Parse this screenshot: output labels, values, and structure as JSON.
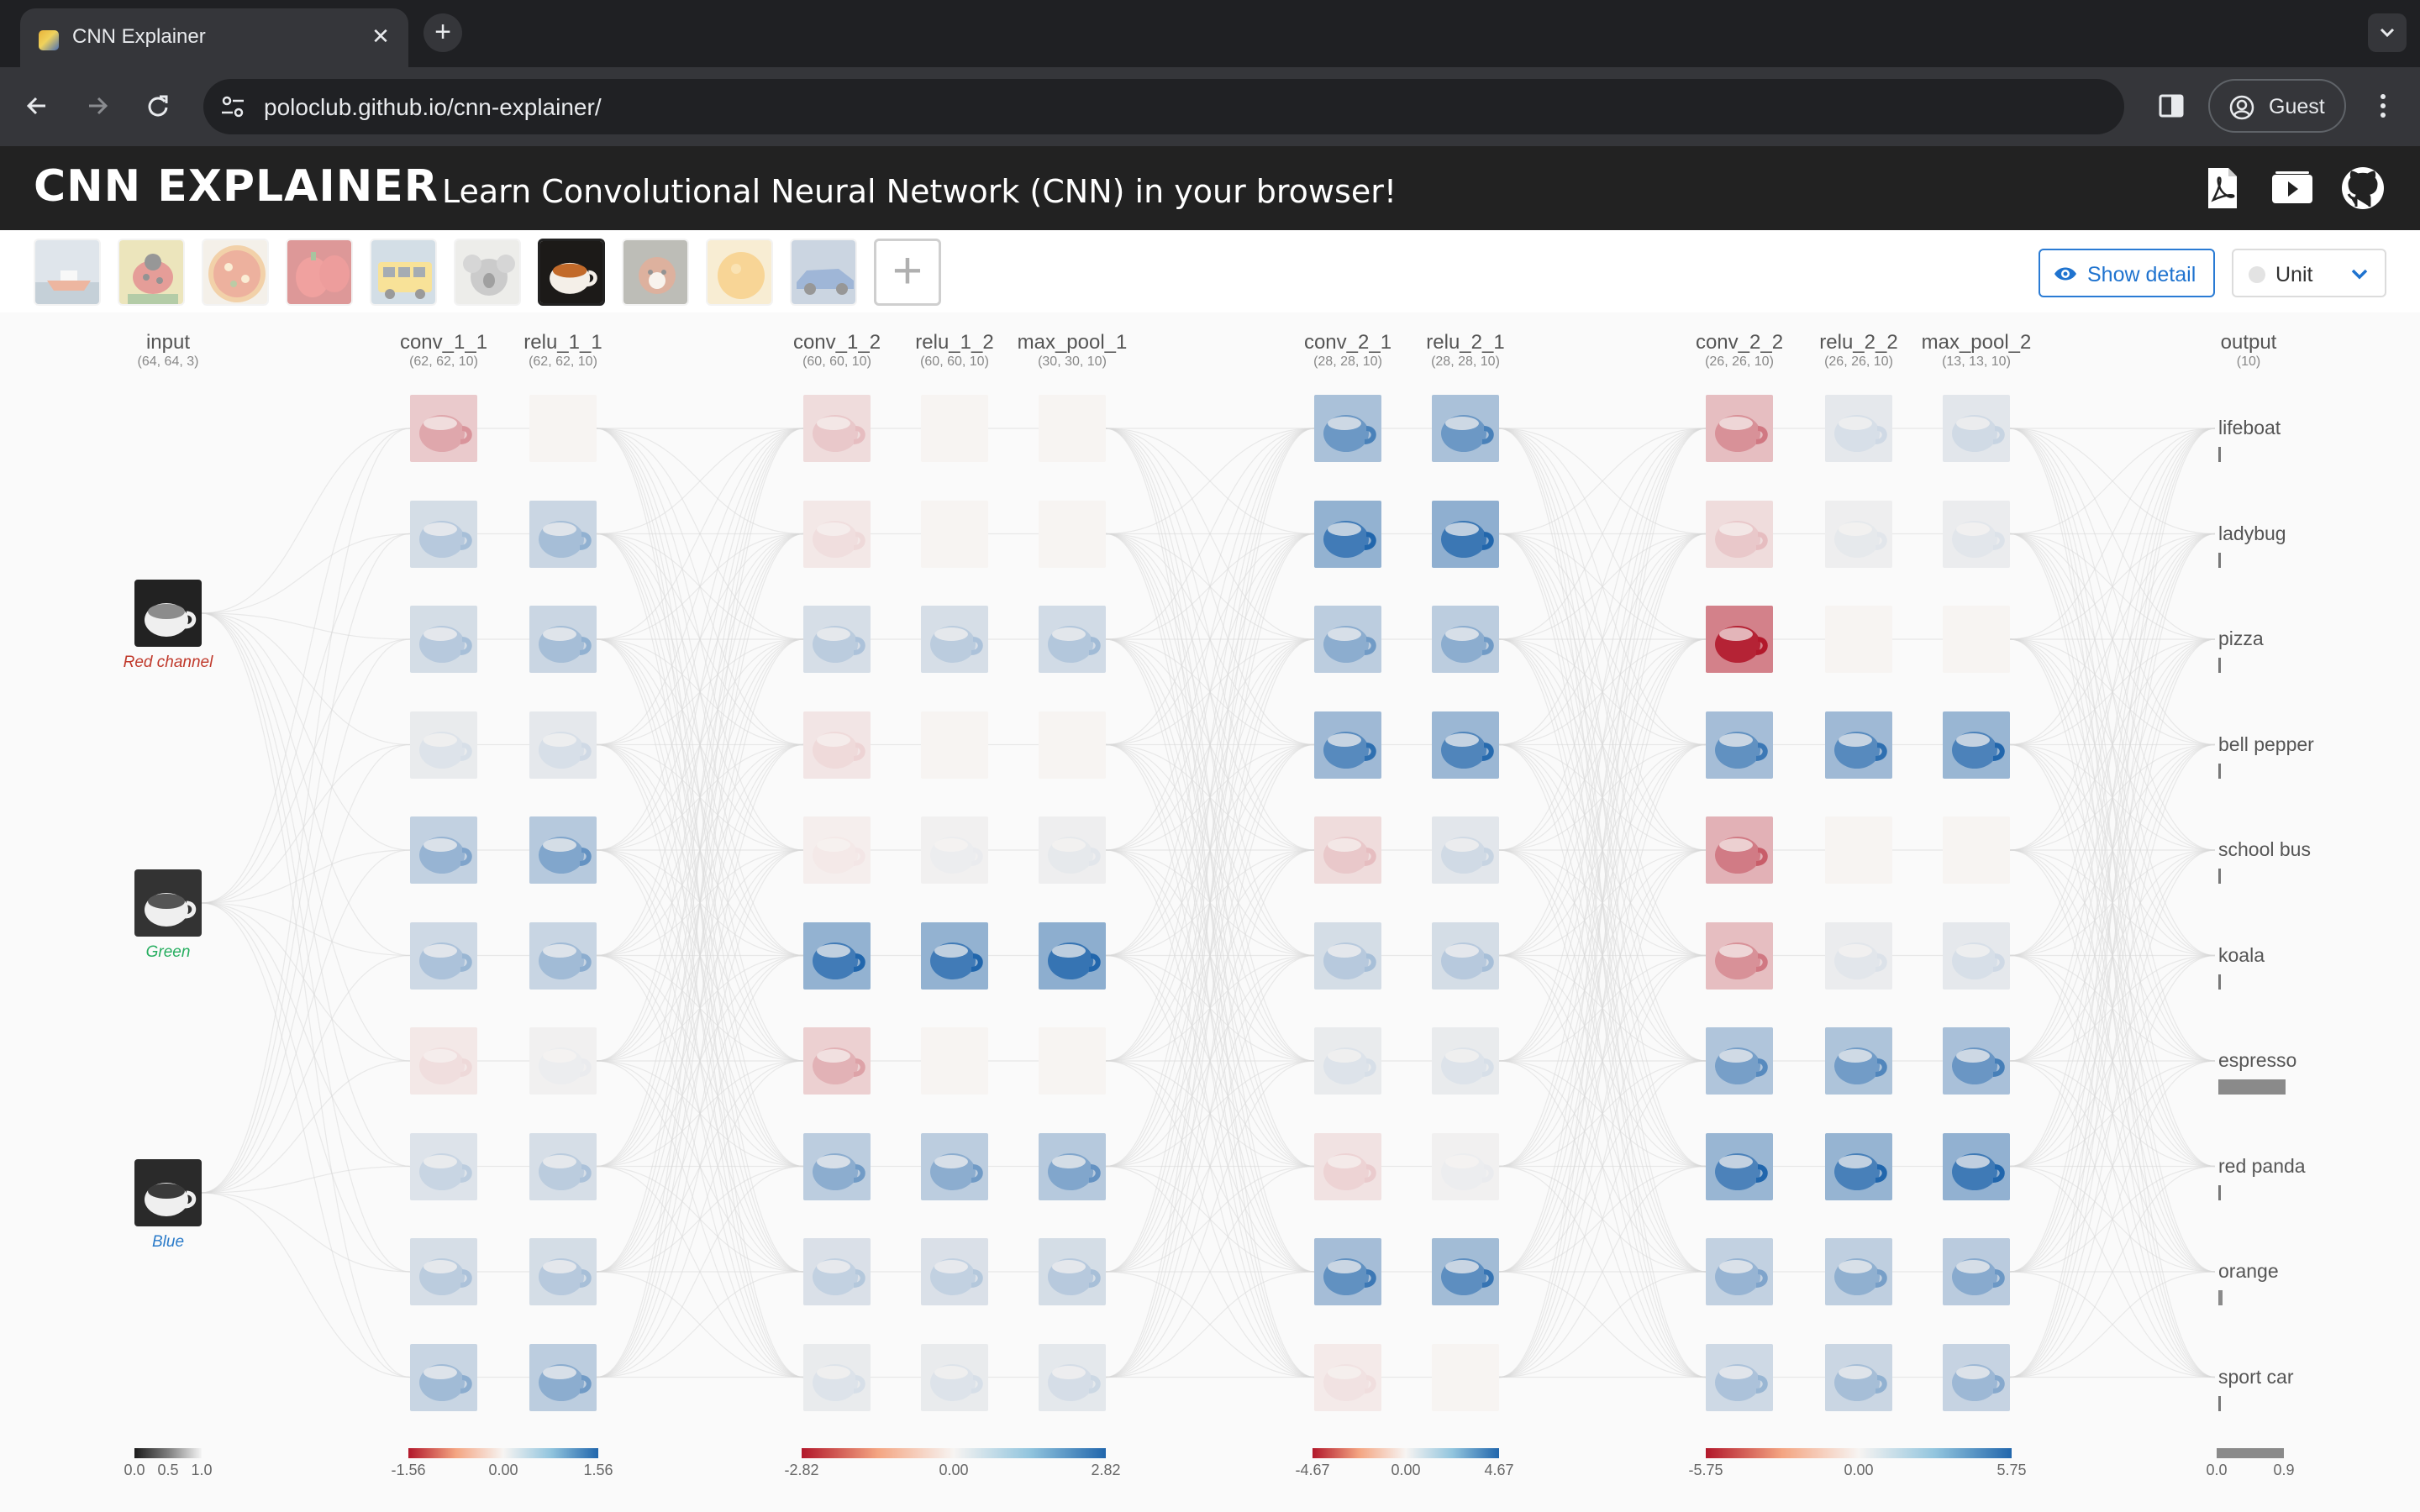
{
  "browser": {
    "tab_title": "CNN Explainer",
    "tab_close": "✕",
    "new_tab": "+",
    "url": "poloclub.github.io/cnn-explainer/",
    "profile_label": "Guest"
  },
  "app": {
    "title": "CNN EXPLAINER",
    "subtitle": "Learn Convolutional Neural Network (CNN) in your browser!"
  },
  "controls": {
    "add_image": "+",
    "show_detail": "Show detail",
    "unit_selected": "Unit"
  },
  "columns": [
    {
      "title": "input",
      "shape": "(64, 64, 3)"
    },
    {
      "title": "conv_1_1",
      "shape": "(62, 62, 10)"
    },
    {
      "title": "relu_1_1",
      "shape": "(62, 62, 10)"
    },
    {
      "title": "conv_1_2",
      "shape": "(60, 60, 10)"
    },
    {
      "title": "relu_1_2",
      "shape": "(60, 60, 10)"
    },
    {
      "title": "max_pool_1",
      "shape": "(30, 30, 10)"
    },
    {
      "title": "conv_2_1",
      "shape": "(28, 28, 10)"
    },
    {
      "title": "relu_2_1",
      "shape": "(28, 28, 10)"
    },
    {
      "title": "conv_2_2",
      "shape": "(26, 26, 10)"
    },
    {
      "title": "relu_2_2",
      "shape": "(26, 26, 10)"
    },
    {
      "title": "max_pool_2",
      "shape": "(13, 13, 10)"
    },
    {
      "title": "output",
      "shape": "(10)"
    }
  ],
  "input_channels": [
    {
      "label": "Red channel",
      "color": "#c0392b"
    },
    {
      "label": "Green",
      "color": "#27ae60"
    },
    {
      "label": "Blue",
      "color": "#2b7bc9"
    }
  ],
  "output_classes": [
    {
      "label": "lifeboat",
      "score": 0.0
    },
    {
      "label": "ladybug",
      "score": 0.01
    },
    {
      "label": "pizza",
      "score": 0.0
    },
    {
      "label": "bell pepper",
      "score": 0.03
    },
    {
      "label": "school bus",
      "score": 0.0
    },
    {
      "label": "koala",
      "score": 0.0
    },
    {
      "label": "espresso",
      "score": 0.87
    },
    {
      "label": "red panda",
      "score": 0.01
    },
    {
      "label": "orange",
      "score": 0.05
    },
    {
      "label": "sport car",
      "score": 0.0
    }
  ],
  "legends": [
    {
      "type": "gray",
      "labels": [
        "0.0",
        "0.5",
        "1.0"
      ]
    },
    {
      "type": "diverging",
      "labels": [
        "-1.56",
        "0.00",
        "1.56"
      ]
    },
    {
      "type": "diverging",
      "labels": [
        "-2.82",
        "0.00",
        "2.82"
      ]
    },
    {
      "type": "diverging",
      "labels": [
        "-4.67",
        "0.00",
        "4.67"
      ]
    },
    {
      "type": "diverging",
      "labels": [
        "-5.75",
        "0.00",
        "5.75"
      ]
    },
    {
      "type": "gray",
      "labels": [
        "0.0",
        "0.9"
      ]
    }
  ],
  "activations": {
    "conv_1_1": [
      -0.35,
      0.3,
      0.3,
      0.12,
      0.45,
      0.35,
      -0.1,
      0.22,
      0.28,
      0.4
    ],
    "relu_1_1": [
      0.0,
      0.38,
      0.38,
      0.15,
      0.55,
      0.4,
      0.05,
      0.28,
      0.3,
      0.5
    ],
    "conv_1_2": [
      -0.2,
      -0.1,
      0.28,
      -0.12,
      -0.05,
      0.85,
      -0.3,
      0.5,
      0.25,
      0.12
    ],
    "relu_1_2": [
      0.0,
      0.0,
      0.28,
      0.0,
      0.05,
      0.85,
      0.0,
      0.5,
      0.25,
      0.12
    ],
    "max_pool_1": [
      0.0,
      0.0,
      0.32,
      0.0,
      0.08,
      0.9,
      0.0,
      0.55,
      0.3,
      0.16
    ],
    "conv_2_1": [
      0.65,
      0.85,
      0.5,
      0.75,
      -0.2,
      0.3,
      0.12,
      -0.15,
      0.7,
      -0.08
    ],
    "relu_2_1": [
      0.65,
      0.88,
      0.5,
      0.78,
      0.18,
      0.3,
      0.12,
      0.05,
      0.72,
      0.0
    ],
    "conv_2_2": [
      -0.45,
      -0.2,
      -0.95,
      0.7,
      -0.55,
      -0.45,
      0.6,
      0.8,
      0.45,
      0.35
    ],
    "relu_2_2": [
      0.15,
      0.08,
      0.0,
      0.75,
      0.0,
      0.1,
      0.62,
      0.82,
      0.48,
      0.38
    ],
    "max_pool_2": [
      0.18,
      0.1,
      0.0,
      0.8,
      0.0,
      0.15,
      0.66,
      0.86,
      0.52,
      0.42
    ]
  },
  "colors": {
    "positive": "#2166ac",
    "negative": "#b2182b",
    "neutral": "#f7f4f2",
    "edge": "#d9d9d9",
    "accent": "#1f73cf"
  },
  "icons": {
    "header": [
      "pdf-icon",
      "video-icon",
      "github-icon"
    ],
    "show_detail": "eye-icon",
    "unit_select": "chevron-down-icon"
  }
}
